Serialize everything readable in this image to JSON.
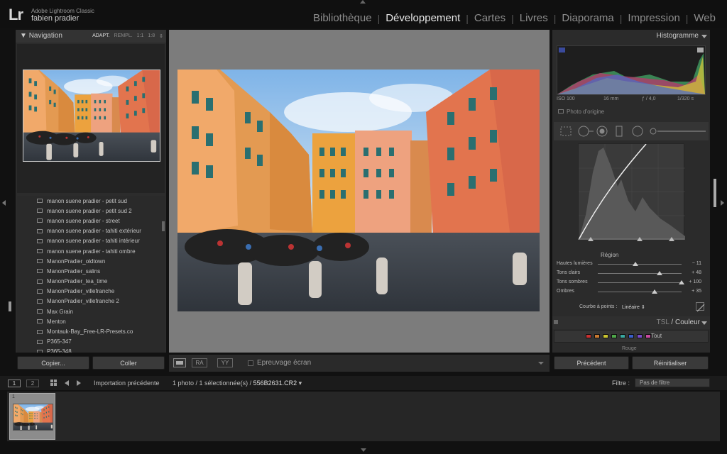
{
  "app": {
    "logo": "Lr",
    "product": "Adobe Lightroom Classic",
    "user": "fabien pradier"
  },
  "modules": [
    {
      "label": "Bibliothèque",
      "active": false
    },
    {
      "label": "Développement",
      "active": true
    },
    {
      "label": "Cartes",
      "active": false
    },
    {
      "label": "Livres",
      "active": false
    },
    {
      "label": "Diaporama",
      "active": false
    },
    {
      "label": "Impression",
      "active": false
    },
    {
      "label": "Web",
      "active": false
    }
  ],
  "navigator": {
    "title": "Navigation",
    "zoom_options": [
      "ADAPT.",
      "REMPL.",
      "1:1",
      "1:8"
    ],
    "active_zoom": "ADAPT."
  },
  "collections": [
    "manon suene pradier - petit sud",
    "manon suene pradier - petit sud 2",
    "manon suene pradier - street",
    "manon suene pradier - tahiti extérieur",
    "manon suene pradier - tahiti intérieur",
    "manon suene pradier - tahiti ombre",
    "ManonPradier_oldtown",
    "ManonPradier_salins",
    "ManonPradier_tea_time",
    "ManonPradier_villefranche",
    "ManonPradier_villefranche 2",
    "Max Grain",
    "Menton",
    "Montauk-Bay_Free-LR-Presets.co",
    "P365-347",
    "P365-348"
  ],
  "left_buttons": {
    "copy": "Copier...",
    "paste": "Coller"
  },
  "toolbar": {
    "ra": "RA",
    "yy": "YY",
    "soft_proof": "Epreuvage écran"
  },
  "histogram": {
    "title": "Histogramme",
    "iso": "ISO 100",
    "focal": "16 mm",
    "aperture": "ƒ / 4,0",
    "shutter": "1/320 s",
    "original": "Photo d'origine"
  },
  "tone_curve": {
    "region_title": "Région",
    "sliders": [
      {
        "label": "Hautes lumières",
        "value": "− 11",
        "level": -11
      },
      {
        "label": "Tons clairs",
        "value": "+ 48",
        "level": 48
      },
      {
        "label": "Tons sombres",
        "value": "+ 100",
        "level": 100
      },
      {
        "label": "Ombres",
        "value": "+ 35",
        "level": 35
      }
    ],
    "points_label": "Courbe à points :",
    "points_value": "Linéaire"
  },
  "tsl": {
    "title_a": "TSL",
    "title_b": "Couleur",
    "all": "Tout",
    "next_label": "Rouge",
    "swatch_colors": [
      "#c93030",
      "#c97a30",
      "#c9c430",
      "#4fa84a",
      "#3aa8a0",
      "#3a5ec9",
      "#7a4ac9",
      "#c94a9e"
    ]
  },
  "right_buttons": {
    "previous": "Précédent",
    "reset": "Réinitialiser"
  },
  "filmstrip": {
    "screen1": "1",
    "screen2": "2",
    "source": "Importation précédente",
    "count": "1 photo / 1 sélectionnée(s) /",
    "filename": "556B2631.CR2",
    "filter_label": "Filtre :",
    "filter_value": "Pas de filtre",
    "thumb_number": "1"
  }
}
